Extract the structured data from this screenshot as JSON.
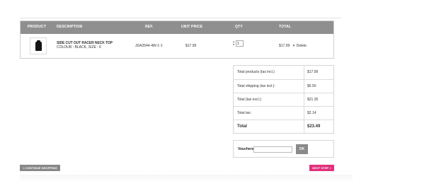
{
  "cart": {
    "headers": {
      "product": "PRODUCT",
      "description": "DESCRIPTION",
      "ref": "REF.",
      "unit_price": "UNIT PRICE",
      "qty": "QTY",
      "total": "TOTAL"
    },
    "item": {
      "name": "SIDE CUT OUT RACER NECK TOP",
      "attributes": "COLOUR : BLACK, SIZE : 6",
      "ref": "JDA2544-4W-1-1",
      "unit_price": "$17.99",
      "qty": "1",
      "total": "$17.99",
      "delete_label": "Delete",
      "delete_icon": "close-icon"
    }
  },
  "totals": {
    "rows": [
      {
        "label": "Total products (tax incl.)",
        "value": "$17.99"
      },
      {
        "label": "Total shipping (tax incl.):",
        "value": "$5.50"
      },
      {
        "label": "Total (tax excl.):",
        "value": "$21.35"
      },
      {
        "label": "Total tax:",
        "value": "$2.14"
      },
      {
        "label": "Total",
        "value": "$23.49"
      }
    ]
  },
  "vouchers": {
    "label": "Vouchers",
    "input_value": "",
    "ok_label": "OK"
  },
  "nav": {
    "continue_label": "« CONTINUE SHOPPING",
    "next_label": "NEXT STEP »"
  },
  "colors": {
    "header_bg": "#8f8f8f",
    "next_button": "#e0307c",
    "grey_button": "#888888"
  }
}
